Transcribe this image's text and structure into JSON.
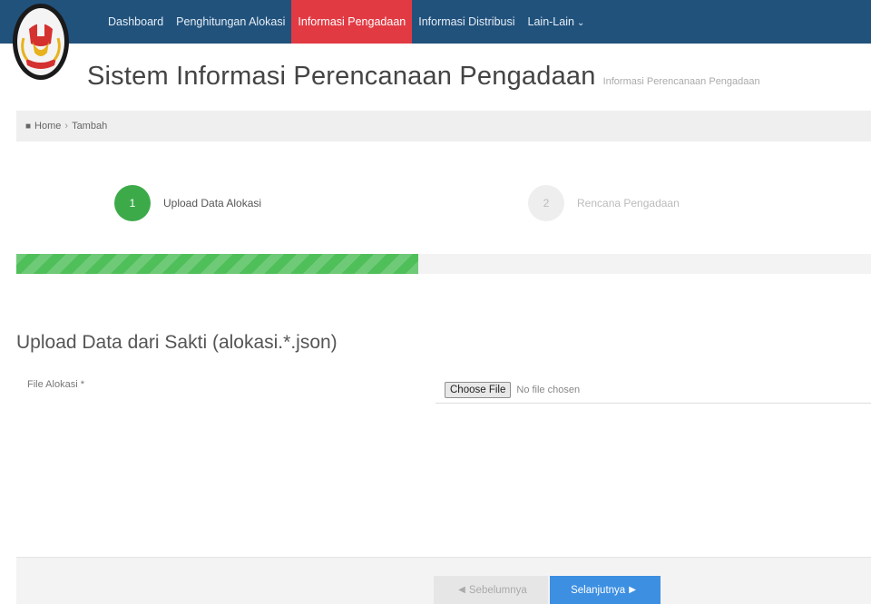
{
  "nav": {
    "items": [
      {
        "label": "Dashboard"
      },
      {
        "label": "Penghitungan Alokasi"
      },
      {
        "label": "Informasi Pengadaan",
        "active": true
      },
      {
        "label": "Informasi Distribusi"
      },
      {
        "label": "Lain-Lain"
      }
    ],
    "colors": {
      "bar": "#21527c",
      "active": "#e23a43"
    }
  },
  "page": {
    "title": "Sistem Informasi Perencanaan Pengadaan",
    "subtitle": "Informasi Perencanaan Pengadaan"
  },
  "breadcrumb": {
    "home": "Home",
    "current": "Tambah"
  },
  "wizard": {
    "steps": [
      {
        "number": "1",
        "label": "Upload Data Alokasi",
        "state": "active",
        "color": "#3daa4a"
      },
      {
        "number": "2",
        "label": "Rencana Pengadaan",
        "state": "inactive"
      }
    ],
    "progress_fraction": 0.47
  },
  "upload": {
    "heading": "Upload Data dari Sakti (alokasi.*.json)",
    "field_label": "File Alokasi *",
    "button_label": "Choose File",
    "status_text": "No file chosen"
  },
  "footer": {
    "prev_label": "Sebelumnya",
    "next_label": "Selanjutnya",
    "next_color": "#3d8fe2"
  }
}
